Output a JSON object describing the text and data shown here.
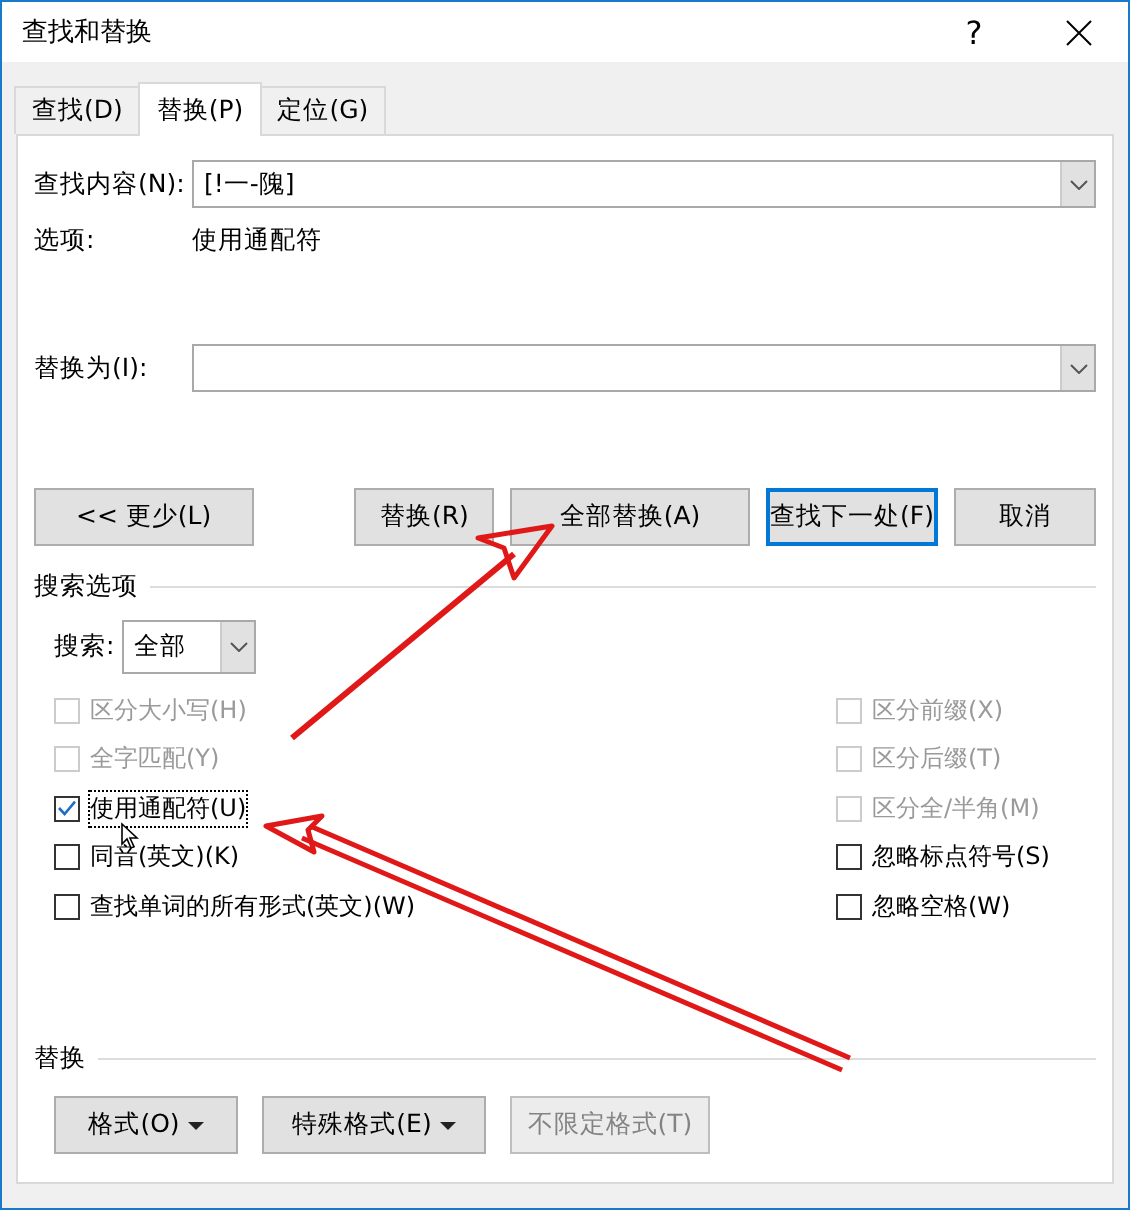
{
  "window": {
    "title": "查找和替换",
    "help": "?"
  },
  "tabs": [
    {
      "label": "查找(D)",
      "selected": false
    },
    {
      "label": "替换(P)",
      "selected": true
    },
    {
      "label": "定位(G)",
      "selected": false
    }
  ],
  "find": {
    "label": "查找内容(N):",
    "value": "[!一-隗]"
  },
  "options": {
    "label": "选项:",
    "value": "使用通配符"
  },
  "replace": {
    "label": "替换为(I):"
  },
  "buttons": [
    {
      "label": "<< 更少(L)",
      "default": false
    },
    {
      "label": "替换(R)",
      "default": false
    },
    {
      "label": "全部替换(A)",
      "default": false
    },
    {
      "label": "查找下一处(F)",
      "default": true
    },
    {
      "label": "取消",
      "default": false
    }
  ],
  "search_options": {
    "title": "搜索选项",
    "search_label": "搜索:",
    "search_value": "全部"
  },
  "left_checks": [
    {
      "label": "区分大小写(H)",
      "checked": false,
      "disabled": true
    },
    {
      "label": "全字匹配(Y)",
      "checked": false,
      "disabled": true
    },
    {
      "label": "使用通配符(U)",
      "checked": true,
      "disabled": false
    },
    {
      "label": "同音(英文)(K)",
      "checked": false,
      "disabled": false
    },
    {
      "label": "查找单词的所有形式(英文)(W)",
      "checked": false,
      "disabled": false
    }
  ],
  "right_checks": [
    {
      "label": "区分前缀(X)",
      "checked": false,
      "disabled": true
    },
    {
      "label": "区分后缀(T)",
      "checked": false,
      "disabled": true
    },
    {
      "label": "区分全/半角(M)",
      "checked": false,
      "disabled": true
    },
    {
      "label": "忽略标点符号(S)",
      "checked": false,
      "disabled": false
    },
    {
      "label": "忽略空格(W)",
      "checked": false,
      "disabled": false
    }
  ],
  "replace_section": {
    "title": "替换",
    "buttons": [
      {
        "label": "格式(O)",
        "dropdown": true,
        "disabled": false
      },
      {
        "label": "特殊格式(E)",
        "dropdown": true,
        "disabled": false
      },
      {
        "label": "不限定格式(T)",
        "dropdown": false,
        "disabled": true
      }
    ]
  }
}
